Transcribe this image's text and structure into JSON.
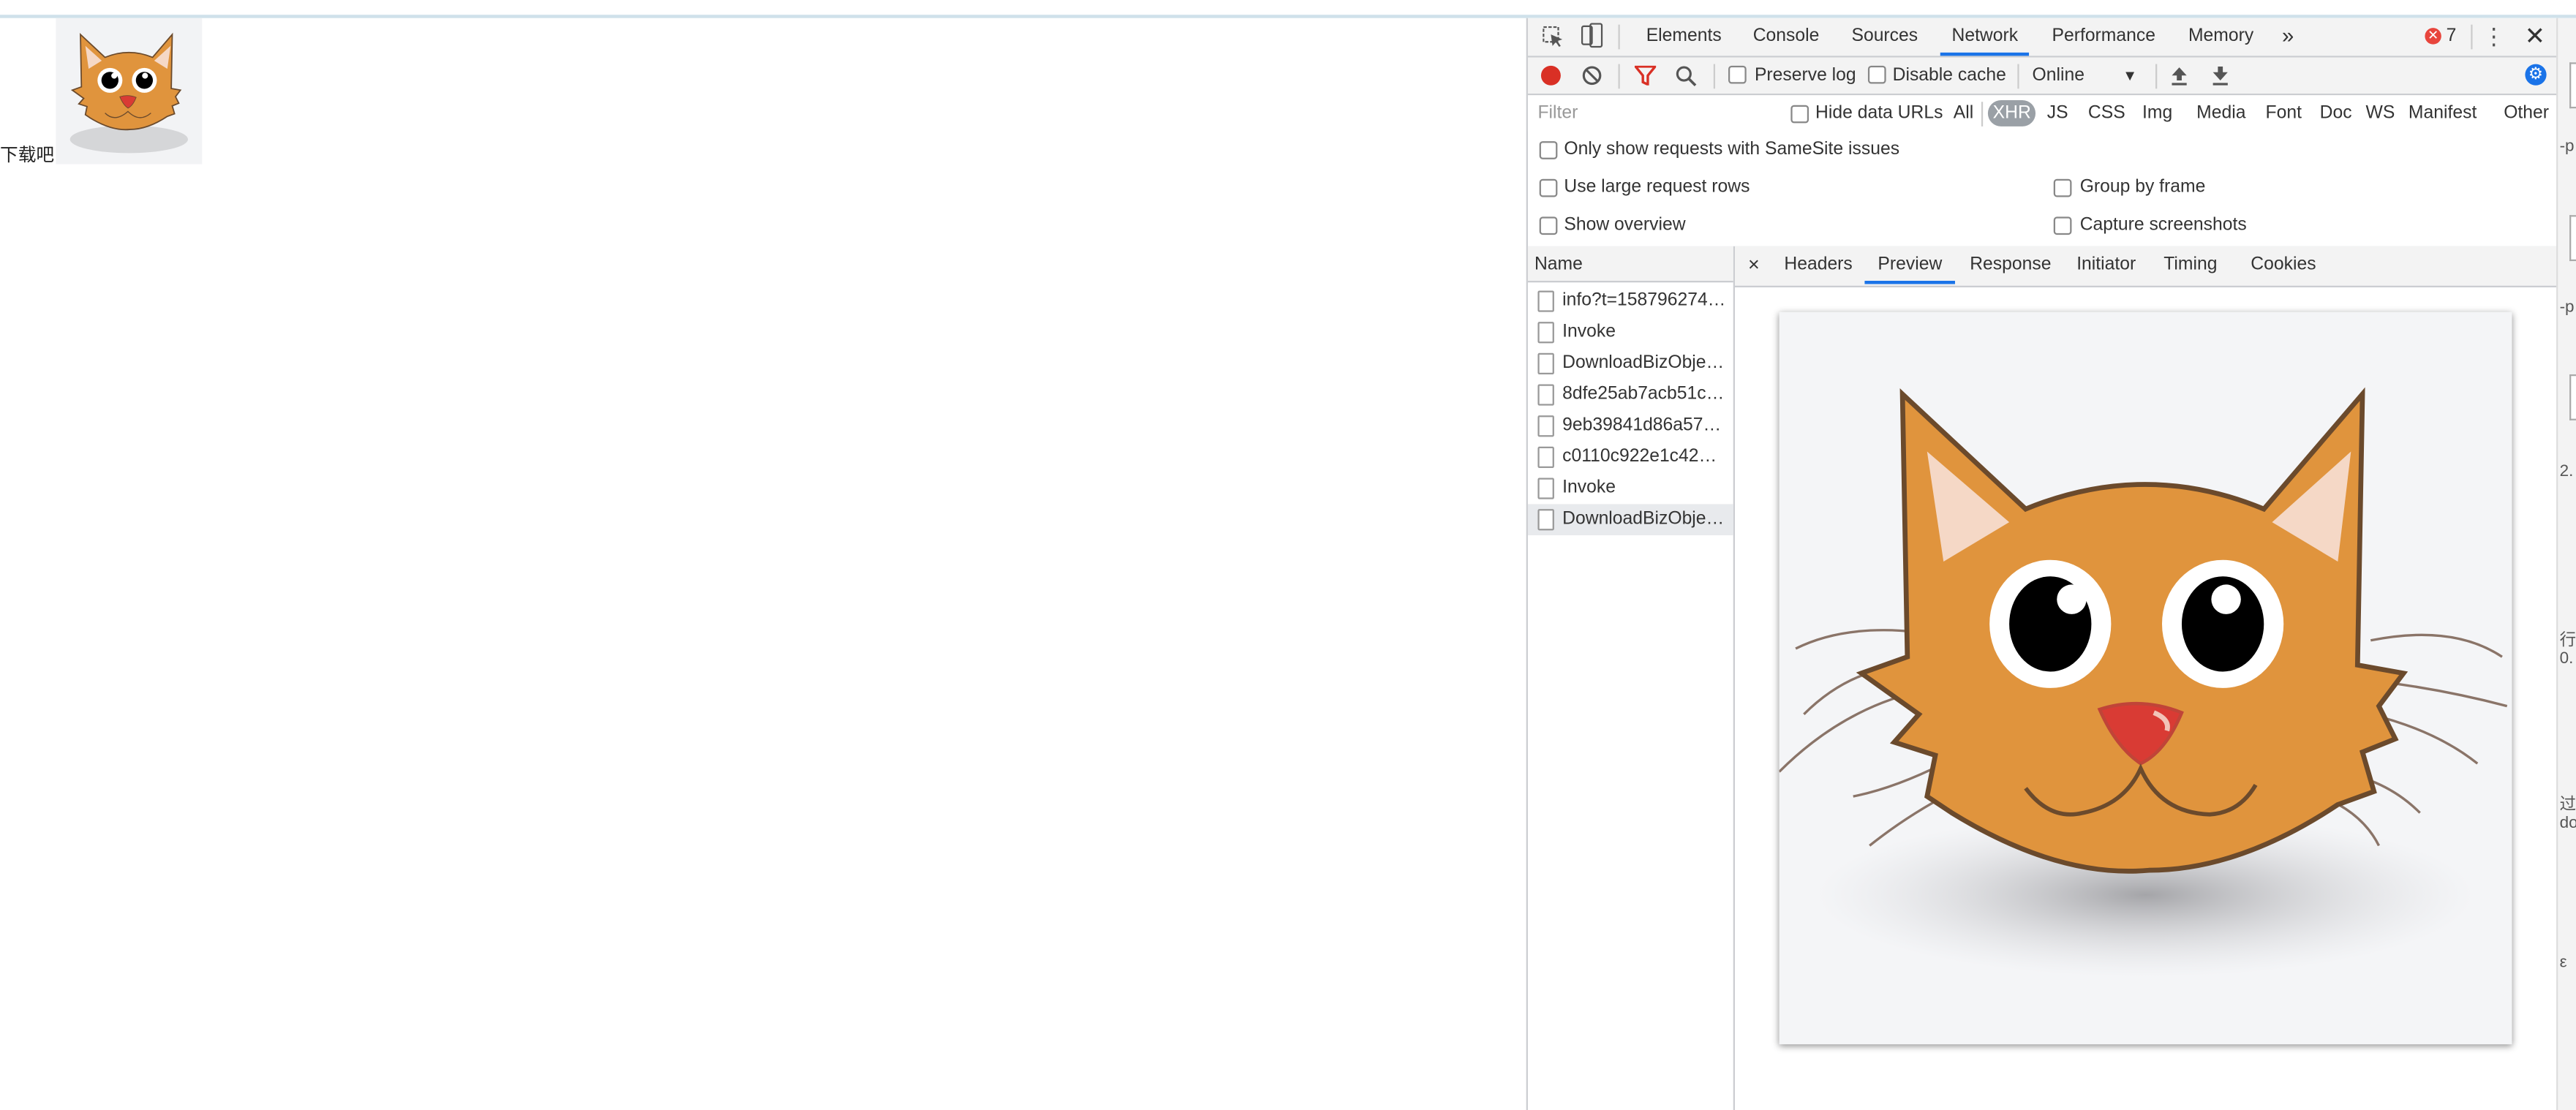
{
  "page": {
    "download_link": "下载吧"
  },
  "devtools": {
    "tabs": [
      "Elements",
      "Console",
      "Sources",
      "Network",
      "Performance",
      "Memory"
    ],
    "active_tab": "Network",
    "more_tabs": "»",
    "error_count": "7",
    "toolbar": {
      "preserve_log": "Preserve log",
      "disable_cache": "Disable cache",
      "throttling": "Online"
    },
    "filter": {
      "placeholder": "Filter",
      "hide_data_urls": "Hide data URLs",
      "types": [
        "All",
        "XHR",
        "JS",
        "CSS",
        "Img",
        "Media",
        "Font",
        "Doc",
        "WS",
        "Manifest",
        "Other"
      ],
      "active_type": "XHR"
    },
    "options": {
      "samesite": "Only show requests with SameSite issues",
      "large_rows": "Use large request rows",
      "group_by_frame": "Group by frame",
      "show_overview": "Show overview",
      "capture_screenshots": "Capture screenshots"
    },
    "requests": {
      "header": "Name",
      "items": [
        "info?t=158796274…",
        "Invoke",
        "DownloadBizObje…",
        "8dfe25ab7acb51c…",
        "9eb39841d86a57…",
        "c0110c922e1c429…",
        "Invoke",
        "DownloadBizObje…"
      ],
      "selected_index": 7
    },
    "detail": {
      "close": "×",
      "tabs": [
        "Headers",
        "Preview",
        "Response",
        "Initiator",
        "Timing",
        "Cookies"
      ],
      "active_tab": "Preview"
    }
  },
  "right_strip": {
    "fragments": [
      "-p",
      "-p",
      "2.",
      "行",
      "0.",
      "过",
      "do",
      "ε"
    ]
  },
  "colors": {
    "accent": "#1a73e8",
    "record": "#d93025",
    "error": "#e8453c",
    "cat_fur": "#e0943d",
    "cat_nose": "#d93b34"
  }
}
